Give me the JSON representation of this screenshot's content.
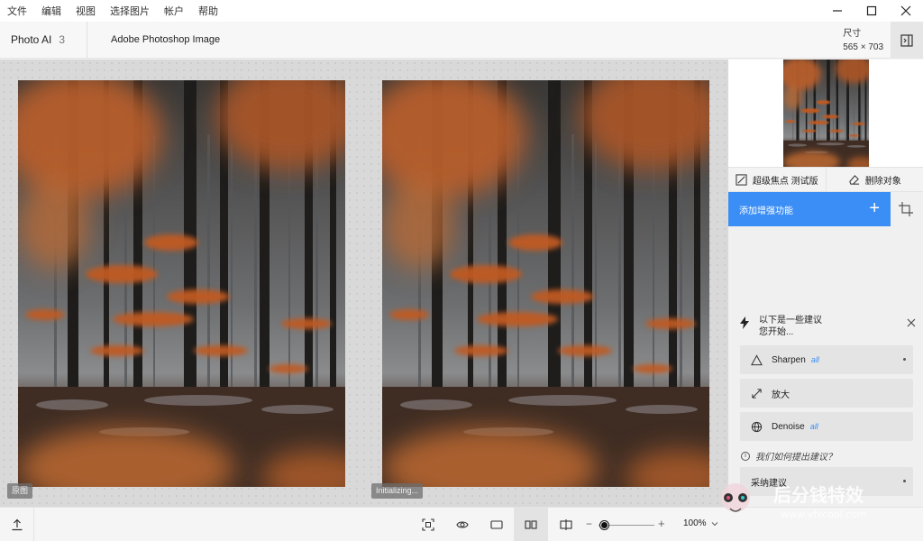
{
  "menu": [
    "文件",
    "编辑",
    "视图",
    "选择图片",
    "帐户",
    "帮助"
  ],
  "header": {
    "app_name": "Photo AI",
    "app_version": "3",
    "document_title": "Adobe Photoshop Image",
    "size_label": "尺寸",
    "size_value": "565 × 703"
  },
  "canvas": {
    "left_badge": "原图",
    "right_badge": "Initializing..."
  },
  "tools": {
    "super_focus": "超级焦点 测试版",
    "remove_object": "删除对象"
  },
  "enhancement": {
    "add_label": "添加增强功能"
  },
  "suggestions": {
    "heading_line1": "以下是一些建议",
    "heading_line2": "您开始...",
    "items": [
      {
        "label": "Sharpen",
        "tag": "all",
        "icon": "triangle-icon"
      },
      {
        "label": "放大",
        "tag": "",
        "icon": "expand-icon"
      },
      {
        "label": "Denoise",
        "tag": "all",
        "icon": "globe-icon"
      }
    ],
    "how_text": "我们如何提出建议？",
    "adopt_label": "采纳建议"
  },
  "bottom": {
    "zoom_value": "100%",
    "zoom_level": 0.1
  },
  "watermark": {
    "text_cn": "后分钱特效",
    "text_url": "www.vfxcool.com"
  },
  "colors": {
    "accent": "#3b8ef5",
    "canvas_bg": "#d9d9d9"
  }
}
